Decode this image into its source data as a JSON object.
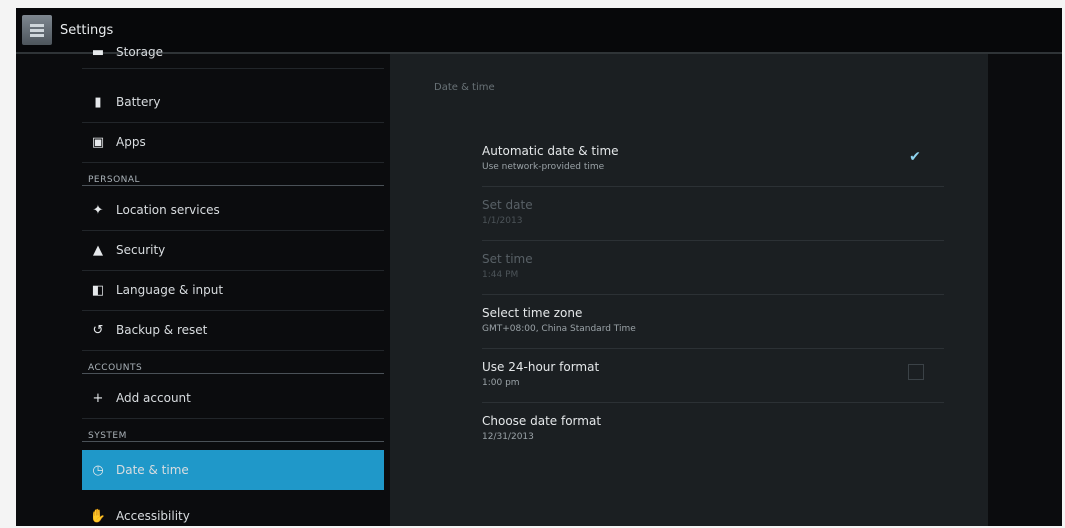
{
  "app": {
    "title": "Settings",
    "icon": "settings-app-icon"
  },
  "sidebar": {
    "items": [
      {
        "label": "Storage",
        "icon": "storage-icon"
      },
      {
        "label": "Battery",
        "icon": "battery-icon"
      },
      {
        "label": "Apps",
        "icon": "apps-icon"
      }
    ],
    "personal_header": "PERSONAL",
    "personal": [
      {
        "label": "Location services",
        "icon": "location-icon"
      },
      {
        "label": "Security",
        "icon": "lock-icon"
      },
      {
        "label": "Language & input",
        "icon": "language-icon"
      },
      {
        "label": "Backup & reset",
        "icon": "backup-icon"
      }
    ],
    "accounts_header": "ACCOUNTS",
    "accounts": [
      {
        "label": "Add account",
        "icon": "plus-icon"
      }
    ],
    "system_header": "SYSTEM",
    "system": [
      {
        "label": "Date & time",
        "icon": "clock-icon",
        "selected": true
      },
      {
        "label": "Accessibility",
        "icon": "accessibility-icon"
      }
    ]
  },
  "detail": {
    "section_title": "Date & time",
    "prefs": [
      {
        "title": "Automatic date & time",
        "summary": "Use network-provided time",
        "checked": true
      },
      {
        "title": "Set date",
        "summary": "1/1/2013",
        "disabled": true
      },
      {
        "title": "Set time",
        "summary": "1:44 PM",
        "disabled": true
      },
      {
        "title": "Select time zone",
        "summary": "GMT+08:00, China Standard Time"
      },
      {
        "title": "Use 24-hour format",
        "summary": "1:00 pm",
        "checked": false
      },
      {
        "title": "Choose date format",
        "summary": "12/31/2013"
      }
    ]
  },
  "colors": {
    "accent": "#1f98c9",
    "background": "#0b0c0e",
    "panel": "#1b1f22"
  }
}
